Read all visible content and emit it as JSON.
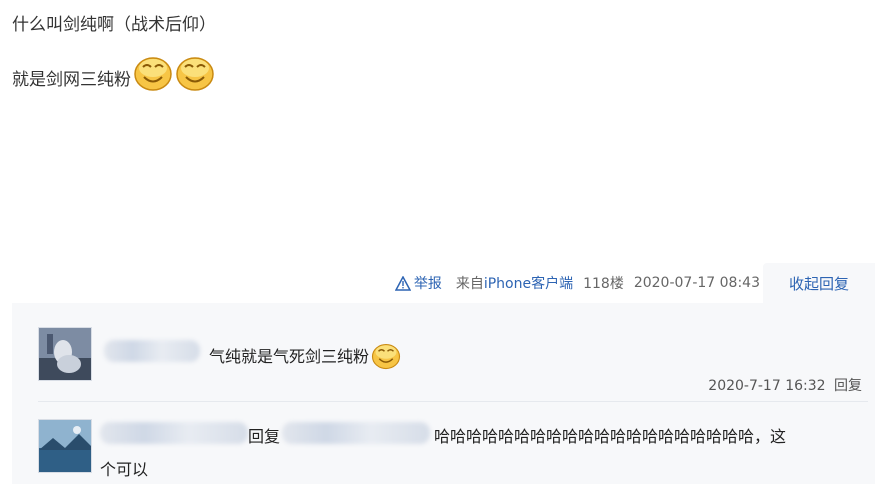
{
  "post": {
    "line1": "什么叫剑纯啊（战术后仰）",
    "line2": "就是剑网三纯粉",
    "emoji": "smiley-face-emoji"
  },
  "meta": {
    "report_label": "举报",
    "source_prefix": "来自",
    "source_device": "iPhone客户端",
    "floor": "118楼",
    "timestamp": "2020-07-17 08:43",
    "collapse_label": "收起回复"
  },
  "replies": [
    {
      "text": "气纯就是气死剑三纯粉",
      "time": "2020-7-17 16:32",
      "reply_label": "回复"
    },
    {
      "reply_word": "回复",
      "text_line1": "哈哈哈哈哈哈哈哈哈哈哈哈哈哈哈哈哈哈哈哈，这",
      "text_line2": "个可以"
    }
  ],
  "colors": {
    "link": "#2d64b3",
    "panel_bg": "#f7f8fa",
    "meta_text": "#666666"
  }
}
